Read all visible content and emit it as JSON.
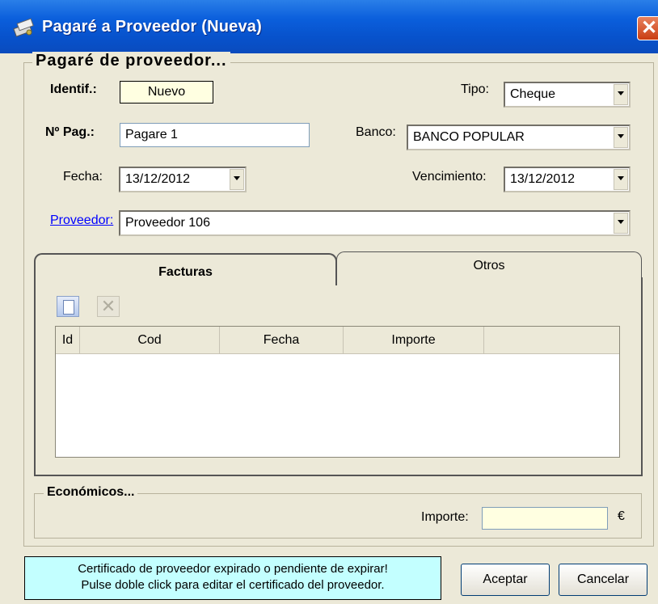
{
  "window": {
    "title": "Pagaré a Proveedor (Nueva)",
    "close": "✕"
  },
  "group_title": "Pagaré de proveedor...",
  "form": {
    "identif_label": "Identif.:",
    "identif_value": "Nuevo",
    "tipo_label": "Tipo:",
    "tipo_value": "Cheque",
    "npag_label": "Nº Pag.:",
    "npag_value": "Pagare 1",
    "banco_label": "Banco:",
    "banco_value": "BANCO POPULAR",
    "fecha_label": "Fecha:",
    "fecha_value": "13/12/2012",
    "venc_label": "Vencimiento:",
    "venc_value": "13/12/2012",
    "proveedor_label": "Proveedor:",
    "proveedor_value": "Proveedor 106"
  },
  "tabs": [
    {
      "label": "Facturas"
    },
    {
      "label": "Otros"
    }
  ],
  "toolbar": {
    "new_icon": "new-document-icon",
    "delete_icon": "delete-icon",
    "delete_glyph": "✕"
  },
  "grid": {
    "columns": [
      "Id",
      "Cod",
      "Fecha",
      "Importe",
      ""
    ]
  },
  "economicos": {
    "title": "Económicos...",
    "importe_label": "Importe:",
    "importe_value": "",
    "currency": "€"
  },
  "status_message": {
    "line1": "Certificado de proveedor expirado o pendiente de expirar!",
    "line2": "Pulse doble click para editar el certificado del proveedor."
  },
  "buttons": {
    "accept": "Aceptar",
    "cancel": "Cancelar"
  },
  "colors": {
    "titlebar": "#0752cc",
    "status_bg": "#c3ffff",
    "highlight_field": "#ffffe1"
  }
}
